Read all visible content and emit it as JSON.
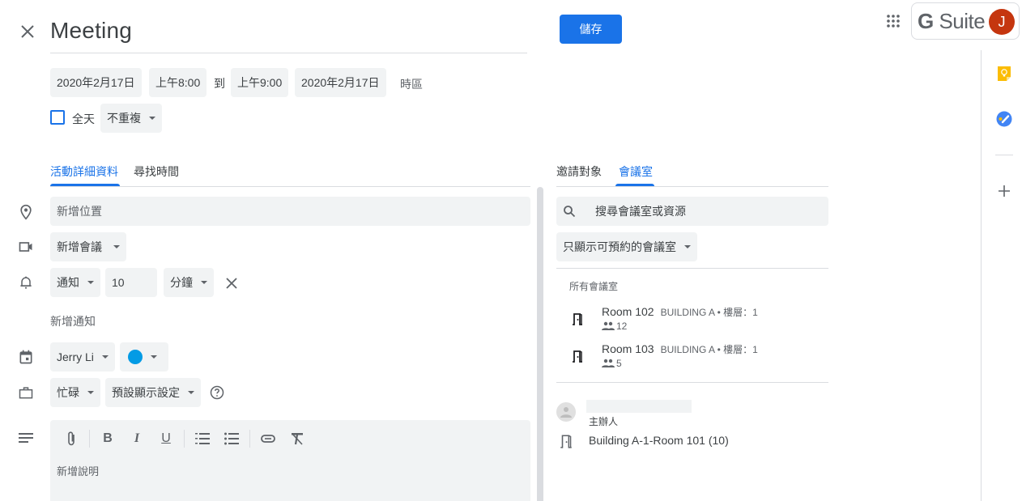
{
  "header": {
    "title": "Meeting",
    "save_label": "儲存",
    "gsuite_g": "G",
    "gsuite_suite": " Suite",
    "avatar_initial": "J",
    "avatar_color": "#c5360f"
  },
  "datetime": {
    "start_date": "2020年2月17日",
    "start_time": "上午8:00",
    "to_label": "到",
    "end_time": "上午9:00",
    "end_date": "2020年2月17日",
    "timezone_label": "時區",
    "all_day_label": "全天",
    "all_day_checked": false,
    "repeat_value": "不重複"
  },
  "left_tabs": [
    {
      "label": "活動詳細資料",
      "active": true
    },
    {
      "label": "尋找時間",
      "active": false
    }
  ],
  "details": {
    "location_placeholder": "新增位置",
    "conference_label": "新增會議",
    "notification_type": "通知",
    "notification_amount": "10",
    "notification_unit": "分鐘",
    "add_notification_label": "新增通知",
    "calendar_owner": "Jerry Li",
    "event_color": "#039be5",
    "availability": "忙碌",
    "visibility": "預設顯示設定",
    "description_placeholder": "新增說明"
  },
  "editor_toolbar": [
    "attach",
    "bold",
    "italic",
    "underline",
    "numbered-list",
    "bulleted-list",
    "link",
    "remove-formatting"
  ],
  "right_tabs": [
    {
      "label": "邀請對象",
      "active": false
    },
    {
      "label": "會議室",
      "active": true
    }
  ],
  "rooms": {
    "search_placeholder": "搜尋會議室或資源",
    "filter_label": "只顯示可預約的會議室",
    "section_label": "所有會議室",
    "list": [
      {
        "name": "Room 102",
        "meta": "BUILDING A • 樓層：1",
        "capacity": "12"
      },
      {
        "name": "Room 103",
        "meta": "BUILDING A • 樓層：1",
        "capacity": "5"
      }
    ],
    "organizer_label": "主辦人",
    "booked_room": "Building A-1-Room 101 (10)"
  },
  "side_panel": [
    "keep",
    "tasks",
    "add"
  ]
}
